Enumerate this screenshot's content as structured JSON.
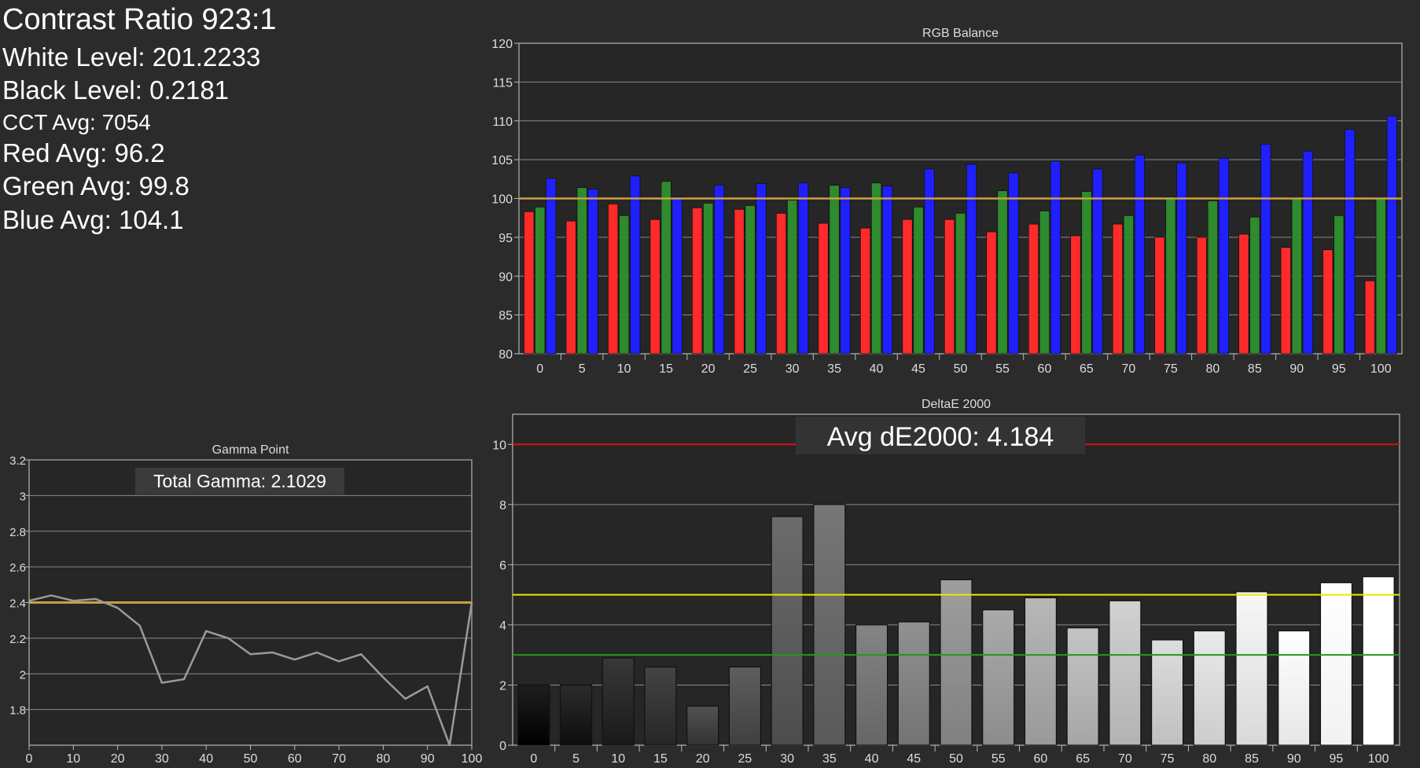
{
  "stats": {
    "contrast": "Contrast Ratio 923:1",
    "white": "White Level: 201.2233",
    "black": "Black Level: 0.2181",
    "cct": "CCT Avg: 7054",
    "red": "Red Avg: 96.2",
    "green": "Green Avg: 99.8",
    "blue": "Blue Avg: 104.1"
  },
  "colors": {
    "background": "#2b2b2b",
    "plot_bg": "#262626",
    "red": "#ff2a2a",
    "green": "#2e8b2e",
    "blue": "#2020ff",
    "target_line": "#c8a040",
    "gamma_line": "#9a9a9a"
  },
  "chart_data": [
    {
      "type": "bar",
      "title": "RGB Balance",
      "categories": [
        "0",
        "5",
        "10",
        "15",
        "20",
        "25",
        "30",
        "35",
        "40",
        "45",
        "50",
        "55",
        "60",
        "65",
        "70",
        "75",
        "80",
        "85",
        "90",
        "95",
        "100"
      ],
      "series": [
        {
          "color": "#ff2a2a",
          "values": [
            98.3,
            97.1,
            99.3,
            97.3,
            98.8,
            98.6,
            98.1,
            96.8,
            96.2,
            97.3,
            97.3,
            95.7,
            96.7,
            95.2,
            96.7,
            95.0,
            95.0,
            95.4,
            93.7,
            93.4,
            89.4
          ]
        },
        {
          "color": "#2e8b2e",
          "values": [
            98.9,
            101.4,
            97.8,
            102.2,
            99.4,
            99.1,
            99.8,
            101.7,
            102.0,
            98.9,
            98.1,
            101.0,
            98.4,
            100.9,
            97.8,
            100.2,
            99.7,
            97.6,
            100.0,
            97.8,
            100.0
          ]
        },
        {
          "color": "#2020ff",
          "values": [
            102.6,
            101.2,
            102.9,
            100.2,
            101.7,
            101.9,
            102.0,
            101.4,
            101.6,
            103.8,
            104.4,
            103.3,
            104.8,
            103.8,
            105.6,
            104.6,
            105.2,
            107.0,
            106.1,
            108.9,
            110.6
          ]
        }
      ],
      "ylim": [
        80,
        120
      ],
      "yticks": [
        80,
        85,
        90,
        95,
        100,
        105,
        110,
        115,
        120
      ],
      "reference": 100,
      "grid": true
    },
    {
      "type": "line",
      "title": "Gamma Point",
      "annotation": "Total Gamma: 2.1029",
      "x": [
        0,
        5,
        10,
        15,
        20,
        25,
        30,
        35,
        40,
        45,
        50,
        55,
        60,
        65,
        70,
        75,
        80,
        85,
        90,
        95,
        100
      ],
      "values": [
        2.41,
        2.44,
        2.41,
        2.42,
        2.37,
        2.27,
        1.95,
        1.97,
        2.24,
        2.2,
        2.11,
        2.12,
        2.08,
        2.12,
        2.07,
        2.11,
        1.98,
        1.86,
        1.93,
        1.6,
        2.4
      ],
      "xticks": [
        0,
        10,
        20,
        30,
        40,
        50,
        60,
        70,
        80,
        90,
        100
      ],
      "yticks": [
        1.8,
        2,
        2.2,
        2.4,
        2.6,
        2.8,
        3,
        3.2
      ],
      "ylim": [
        1.6,
        3.2
      ],
      "reference": 2.4,
      "grid": true
    },
    {
      "type": "bar",
      "title": "DeltaE 2000",
      "annotation": "Avg dE2000: 4.184",
      "categories": [
        "0",
        "5",
        "10",
        "15",
        "20",
        "25",
        "30",
        "35",
        "40",
        "45",
        "50",
        "55",
        "60",
        "65",
        "70",
        "75",
        "80",
        "85",
        "90",
        "95",
        "100"
      ],
      "values": [
        2.0,
        2.0,
        2.9,
        2.6,
        1.3,
        2.6,
        7.6,
        8.0,
        4.0,
        4.1,
        5.5,
        4.5,
        4.9,
        3.9,
        4.8,
        3.5,
        3.8,
        5.1,
        3.8,
        5.4,
        5.6
      ],
      "ylim": [
        0,
        11
      ],
      "yticks": [
        0,
        2,
        4,
        6,
        8,
        10
      ],
      "thresholds": [
        {
          "value": 10,
          "color": "#e01010"
        },
        {
          "value": 5,
          "color": "#e8e800"
        },
        {
          "value": 3,
          "color": "#1f9a1f"
        }
      ],
      "grid": true
    }
  ]
}
